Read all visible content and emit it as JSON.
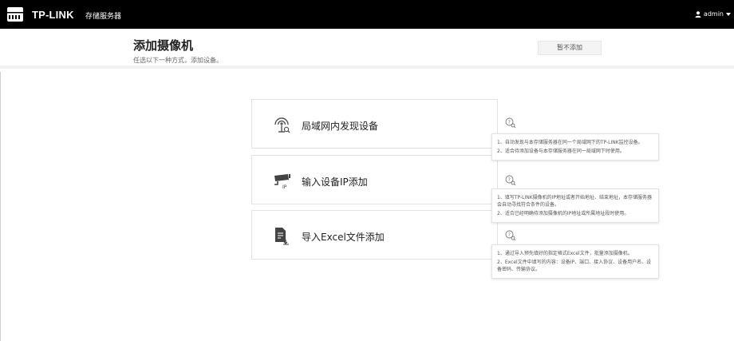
{
  "topbar": {
    "brand": "TP-LINK",
    "product": "存储服务器",
    "user": "admin"
  },
  "header": {
    "title": "添加摄像机",
    "subtitle": "任选以下一种方式，添加设备。",
    "skip_button": "暂不添加"
  },
  "options": [
    {
      "label": "局域网内发现设备",
      "icon": "lan-discover-icon"
    },
    {
      "label": "输入设备IP添加",
      "icon": "ip-camera-icon"
    },
    {
      "label": "导入Excel文件添加",
      "icon": "excel-import-icon"
    }
  ],
  "tips": [
    {
      "lines": [
        "1、自动发现与本存储服务器在同一个局域网下的TP-LINK监控设备。",
        "2、适合待添加设备与本存储服务器在同一局域网下时使用。"
      ]
    },
    {
      "lines": [
        "1、填写TP-LINK摄像机的IP地址或者开始地址、结束地址，本存储服务器会自动寻找符合条件的设备。",
        "2、适合已经明确待添加摄像机的IP地址或所属地址段时使用。"
      ]
    },
    {
      "lines": [
        "1、通过导入预先填好的指定格式Excel文件，批量添加摄像机。",
        "2、Excel文件中填写的内容：设备IP、端口、接入协议、设备用户名、设备密码、传输协议。"
      ]
    }
  ],
  "colors": {
    "topbar": "#000000",
    "divider": "#f0f0f0",
    "card_border": "#e2e2e2"
  }
}
